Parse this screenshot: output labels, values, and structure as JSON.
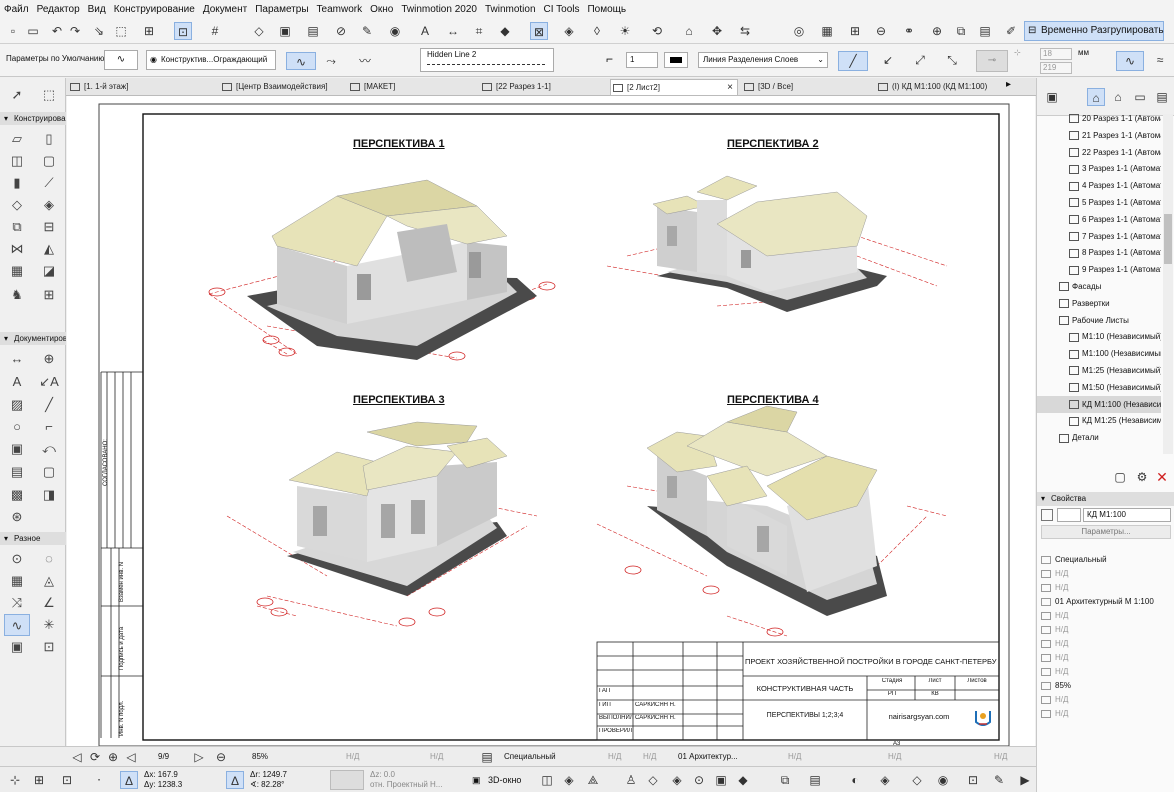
{
  "menu": [
    "Файл",
    "Редактор",
    "Вид",
    "Конструирование",
    "Документ",
    "Параметры",
    "Teamwork",
    "Окно",
    "Twinmotion 2020",
    "Twinmotion",
    "CI Tools",
    "Помощь"
  ],
  "toolbar": {
    "temp_unlock": "Временно Разгрупировать"
  },
  "infobox": {
    "defaults_label": "Параметры по Умолчанию",
    "construct_label": "Конструктив...Ограждающий",
    "line_type": "Hidden Line 2",
    "pen_value": "1",
    "layer_line": "Линия Разделения Слоев",
    "unit": "мм",
    "val_1": "18",
    "val_2": "219"
  },
  "tabs": [
    {
      "label": "[1. 1-й этаж]"
    },
    {
      "label": "[Центр Взаимодействия]"
    },
    {
      "label": "[МАКЕТ]"
    },
    {
      "label": "[22 Разрез 1-1]"
    },
    {
      "label": "[2 Лист2]"
    },
    {
      "label": "[3D / Все]"
    },
    {
      "label": "(I) КД M1:100 (КД M1:100)"
    }
  ],
  "left_panel": {
    "sections": [
      "Конструирование",
      "Документирование",
      "Разное"
    ]
  },
  "drawing": {
    "titles": [
      "ПЕРСПЕКТИВА 1",
      "ПЕРСПЕКТИВА 2",
      "ПЕРСПЕКТИВА 3",
      "ПЕРСПЕКТИВА 4"
    ],
    "agreed": "СОГЛАСОВАНО:",
    "side_labels": [
      "Взамен инв. N",
      "Подпись и дата",
      "Инв. N подл."
    ],
    "stamp": {
      "project": "ПРОЕКТ ХОЗЯЙСТВЕННОЙ ПОСТРОЙКИ В ГОРОДЕ САНКТ-ПЕТЕРБУРГ",
      "part": "КОНСТРУКТИВНАЯ ЧАСТЬ",
      "sheet_name": "ПЕРСПЕКТИВЫ 1;2;3;4",
      "stage_h": "Стадия",
      "sheet_h": "Лист",
      "sheets_h": "Листов",
      "stage": "РП",
      "sheet": "КВ",
      "site": "nairisargsyan.com",
      "roles": [
        "ГАП",
        "ГИП",
        "ВЫПОЛНИЛ",
        "ПРОВЕРИЛ"
      ],
      "names": [
        "",
        "",
        "САРКИСЯН Н.",
        "САРКИСЯН Н."
      ],
      "format": "A3"
    }
  },
  "navigator": {
    "items": [
      {
        "label": "20 Разрез 1-1 (Автомат",
        "indent": 1
      },
      {
        "label": "21 Разрез 1-1 (Автомат",
        "indent": 1
      },
      {
        "label": "22 Разрез 1-1 (Автомат",
        "indent": 1
      },
      {
        "label": "3 Разрез 1-1 (Автомат",
        "indent": 1
      },
      {
        "label": "4 Разрез 1-1 (Автомат",
        "indent": 1
      },
      {
        "label": "5 Разрез 1-1 (Автомат",
        "indent": 1
      },
      {
        "label": "6 Разрез 1-1 (Автомат",
        "indent": 1
      },
      {
        "label": "7 Разрез 1-1 (Автомат",
        "indent": 1
      },
      {
        "label": "8 Разрез 1-1 (Автомат",
        "indent": 1
      },
      {
        "label": "9 Разрез 1-1 (Автомат",
        "indent": 1
      },
      {
        "label": "Фасады",
        "indent": 0
      },
      {
        "label": "Развертки",
        "indent": 0
      },
      {
        "label": "Рабочие Листы",
        "indent": 0
      },
      {
        "label": "M1:10 (Независимый)",
        "indent": 1
      },
      {
        "label": "M1:100 (Независимый)",
        "indent": 1
      },
      {
        "label": "M1:25 (Независимый)",
        "indent": 1
      },
      {
        "label": "M1:50 (Независимый)",
        "indent": 1
      },
      {
        "label": "КД M1:100 (Независим",
        "indent": 1
      },
      {
        "label": "КД M1:25 (Независимы",
        "indent": 1
      },
      {
        "label": "Детали",
        "indent": 0
      }
    ],
    "selected_index": 17
  },
  "properties": {
    "header": "Свойства",
    "name_value": "КД M1:100",
    "params_button": "Параметры...",
    "rows": [
      "Специальный",
      "Н/Д",
      "Н/Д",
      "01 Архитектурный М 1:100",
      "Н/Д",
      "Н/Д",
      "Н/Д",
      "Н/Д",
      "Н/Д",
      "85%",
      "Н/Д",
      "Н/Д"
    ]
  },
  "status": {
    "page": "9/9",
    "zoom": "85%",
    "nd1": "Н/Д",
    "nd2": "Н/Д",
    "special": "Специальный",
    "nd3": "Н/Д",
    "nd4": "Н/Д",
    "arch": "01 Архитектур...",
    "nd5": "Н/Д",
    "nd6": "Н/Д",
    "nd7": "Н/Д"
  },
  "coords": {
    "dx": "Δx: 167.9",
    "dy": "Δy: 1238.3",
    "dr": "Δr: 1249.7",
    "angle": "∢: 82.28°",
    "dz": "Δz: 0.0",
    "ref": "отн. Проектный Н...",
    "view3d": "3D-окно"
  },
  "colors": {
    "accent": "#cfe0f7",
    "roof": "#e6e2b6",
    "wall": "#d9d9d9",
    "shadow": "#555555",
    "dim": "#d02020"
  }
}
